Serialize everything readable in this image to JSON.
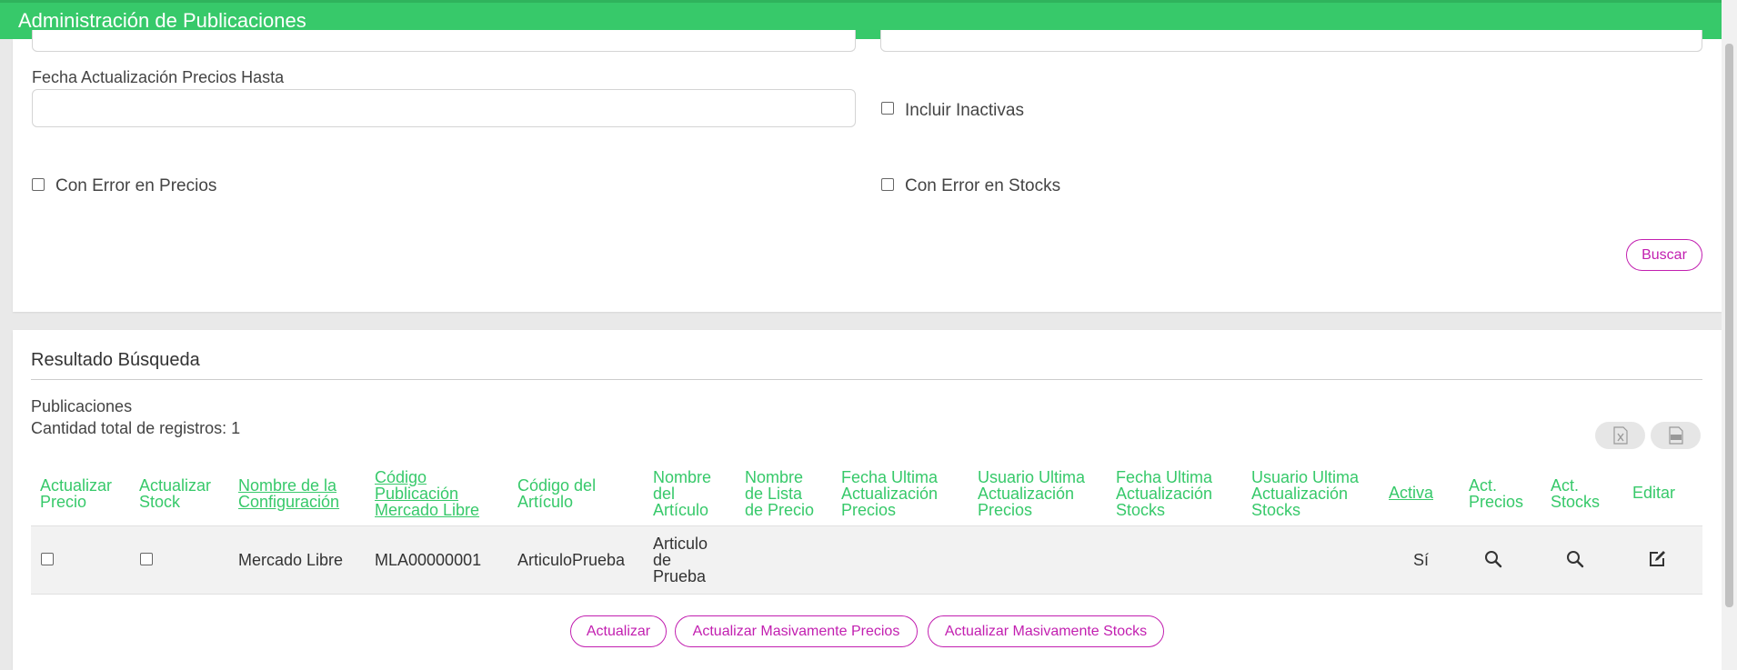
{
  "header": {
    "title": "Administración de Publicaciones"
  },
  "filters": {
    "fecha_hasta_label": "Fecha Actualización Precios Hasta",
    "fecha_hasta_value": "",
    "incluir_inactivas_label": "Incluir Inactivas",
    "error_precios_label": "Con Error en Precios",
    "error_stocks_label": "Con Error en Stocks",
    "buscar_label": "Buscar"
  },
  "results": {
    "section_title": "Resultado Búsqueda",
    "list_title": "Publicaciones",
    "count_text": "Cantidad total de registros: 1",
    "export_icons": [
      "excel-icon",
      "csv-icon"
    ],
    "columns": {
      "actualizar_precio": [
        "Actualizar",
        "Precio"
      ],
      "actualizar_stock": [
        "Actualizar",
        "Stock"
      ],
      "nombre_config": [
        "Nombre de la",
        "Configuración"
      ],
      "codigo_pub": [
        "Código",
        "Publicación",
        "Mercado Libre"
      ],
      "codigo_articulo": [
        "Código del",
        "Artículo"
      ],
      "nombre_articulo": [
        "Nombre",
        "del",
        "Artículo"
      ],
      "nombre_lista": [
        "Nombre",
        "de Lista",
        "de Precio"
      ],
      "fecha_ult_precios": [
        "Fecha Ultima",
        "Actualización",
        "Precios"
      ],
      "usuario_ult_precios": [
        "Usuario Ultima",
        "Actualización",
        "Precios"
      ],
      "fecha_ult_stocks": [
        "Fecha Ultima",
        "Actualización",
        "Stocks"
      ],
      "usuario_ult_stocks": [
        "Usuario Ultima",
        "Actualización",
        "Stocks"
      ],
      "activa": [
        "Activa"
      ],
      "act_precios": [
        "Act.",
        "Precios"
      ],
      "act_stocks": [
        "Act.",
        "Stocks"
      ],
      "editar": [
        "Editar"
      ]
    },
    "rows": [
      {
        "configuracion": "Mercado Libre",
        "codigo_pub": "MLA00000001",
        "codigo_articulo": "ArticuloPrueba",
        "nombre_articulo": [
          "Articulo",
          "de",
          "Prueba"
        ],
        "activa": "Sí"
      }
    ],
    "buttons": {
      "actualizar": "Actualizar",
      "masivo_precios": "Actualizar Masivamente Precios",
      "masivo_stocks": "Actualizar Masivamente Stocks"
    }
  },
  "colors": {
    "header": "#37c96a",
    "accent": "#c21fb0",
    "link": "#37c96a"
  }
}
